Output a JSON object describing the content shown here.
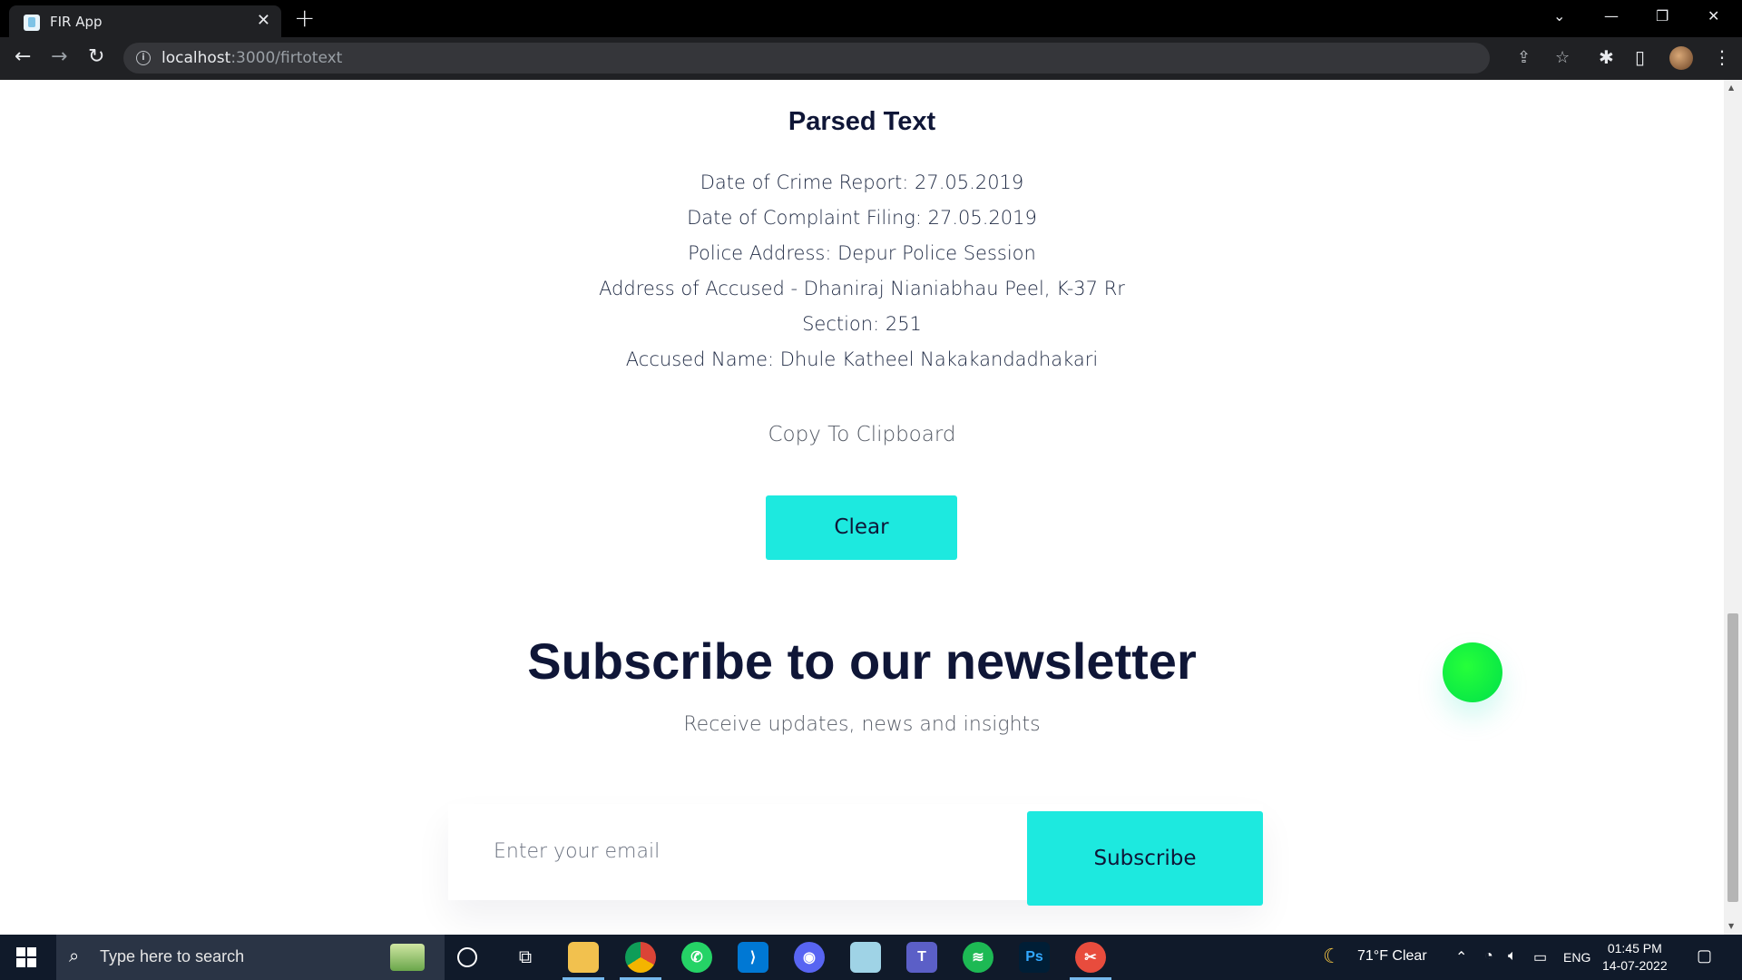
{
  "browser": {
    "tab_title": "FIR App",
    "tab_close": "✕",
    "new_tab": "+",
    "url_host": "localhost",
    "url_path": ":3000/firtotext"
  },
  "parsed": {
    "title": "Parsed Text",
    "lines": [
      "Date of Crime Report: 27.05.2019",
      "Date of Complaint Filing: 27.05.2019",
      "Police Address: Depur Police Session",
      "Address of Accused - Dhaniraj Nianiabhau Peel, K-37 Rr",
      "Section: 251",
      "Accused Name: Dhule Katheel Nakakandadhakari"
    ],
    "copy_label": "Copy To Clipboard",
    "clear_label": "Clear"
  },
  "newsletter": {
    "title": "Subscribe to our newsletter",
    "subtitle": "Receive updates, news and insights",
    "email_placeholder": "Enter your email",
    "subscribe_label": "Subscribe"
  },
  "taskbar": {
    "search_placeholder": "Type here to search",
    "weather": "71°F  Clear",
    "language": "ENG",
    "time": "01:45 PM",
    "date": "14-07-2022"
  },
  "colors": {
    "accent": "#1de9df",
    "heading": "#0f1637",
    "dot": "#1aff3c"
  }
}
